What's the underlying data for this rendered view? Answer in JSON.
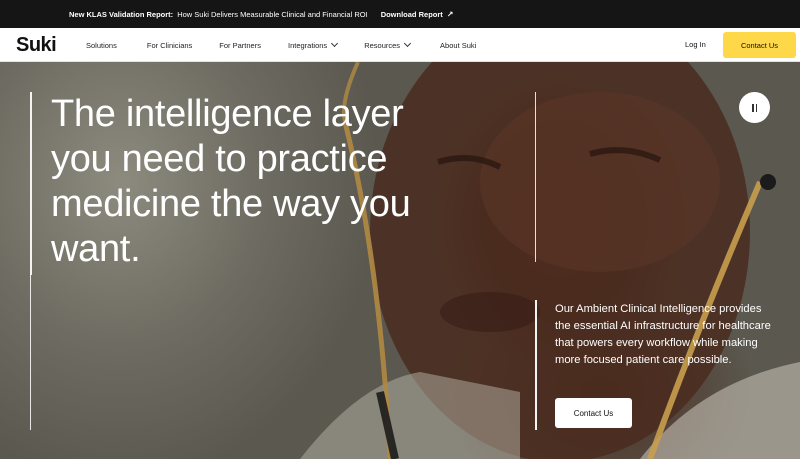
{
  "announcement": {
    "label": "New KLAS Validation Report:",
    "text": "How Suki Delivers Measurable Clinical and Financial ROI",
    "link": "Download Report",
    "link_icon": "arrow-up-right-icon"
  },
  "header": {
    "logo": "Suki",
    "nav": [
      {
        "label": "Solutions",
        "dropdown": false
      },
      {
        "label": "For Clinicians",
        "dropdown": false
      },
      {
        "label": "For Partners",
        "dropdown": false
      },
      {
        "label": "Integrations",
        "dropdown": true
      },
      {
        "label": "Resources",
        "dropdown": true
      },
      {
        "label": "About Suki",
        "dropdown": false
      }
    ],
    "login": "Log In",
    "cta": "Contact Us"
  },
  "hero": {
    "headline": "The intelligence layer you need to practice medicine the way you want.",
    "description": "Our Ambient Clinical Intelligence provides the essential AI infrastructure for healthcare that powers every workflow while making more focused patient care possible.",
    "cta": "Contact Us",
    "pause_icon": "pause-icon"
  },
  "colors": {
    "accent": "#ffd84a",
    "announcement_bg": "#151515"
  }
}
